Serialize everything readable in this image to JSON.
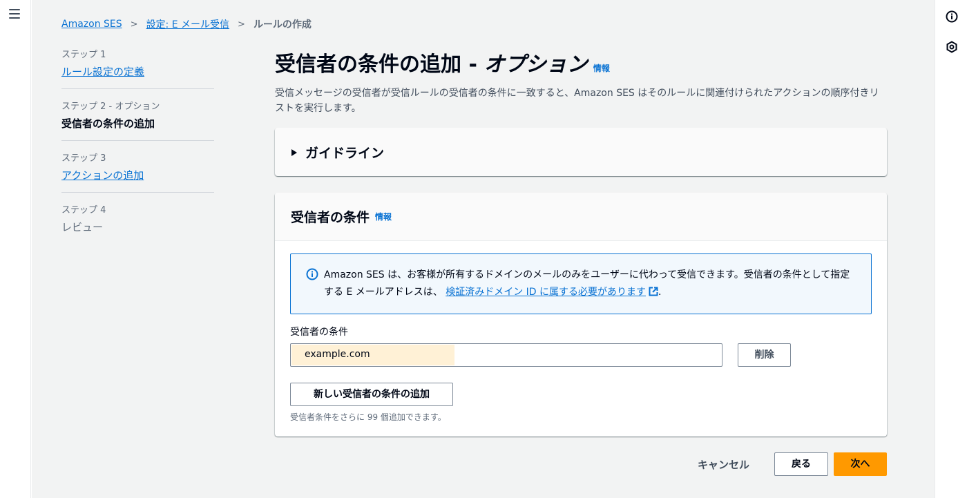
{
  "breadcrumb": {
    "items": [
      "Amazon SES",
      "設定: E メール受信"
    ],
    "current": "ルールの作成"
  },
  "steps": [
    {
      "num": "ステップ 1",
      "label": "ルール設定の定義",
      "state": "link"
    },
    {
      "num": "ステップ 2 - オプション",
      "label": "受信者の条件の追加",
      "state": "current"
    },
    {
      "num": "ステップ 3",
      "label": "アクションの追加",
      "state": "link"
    },
    {
      "num": "ステップ 4",
      "label": "レビュー",
      "state": "disabled"
    }
  ],
  "page": {
    "title": "受信者の条件の追加 -",
    "title_optional": "オプション",
    "info": "情報",
    "description": "受信メッセージの受信者が受信ルールの受信者の条件に一致すると、Amazon SES はそのルールに関連付けられたアクションの順序付きリストを実行します。"
  },
  "guide": {
    "title": "ガイドライン"
  },
  "conditions": {
    "title": "受信者の条件",
    "info": "情報",
    "alert_text": "Amazon SES は、お客様が所有するドメインのメールのみをユーザーに代わって受信できます。受信者の条件として指定する E メールアドレスは、",
    "alert_link": "検証済みドメイン ID に属する必要があります",
    "alert_end": ".",
    "field_label": "受信者の条件",
    "field_value": "example.com",
    "delete_label": "削除",
    "add_label": "新しい受信者の条件の追加",
    "hint": "受信者条件をさらに 99 個追加できます。"
  },
  "footer": {
    "cancel": "キャンセル",
    "back": "戻る",
    "next": "次へ"
  },
  "colors": {
    "accent": "#0972d3",
    "primary_button": "#ff9900",
    "background": "#f2f3f3"
  }
}
